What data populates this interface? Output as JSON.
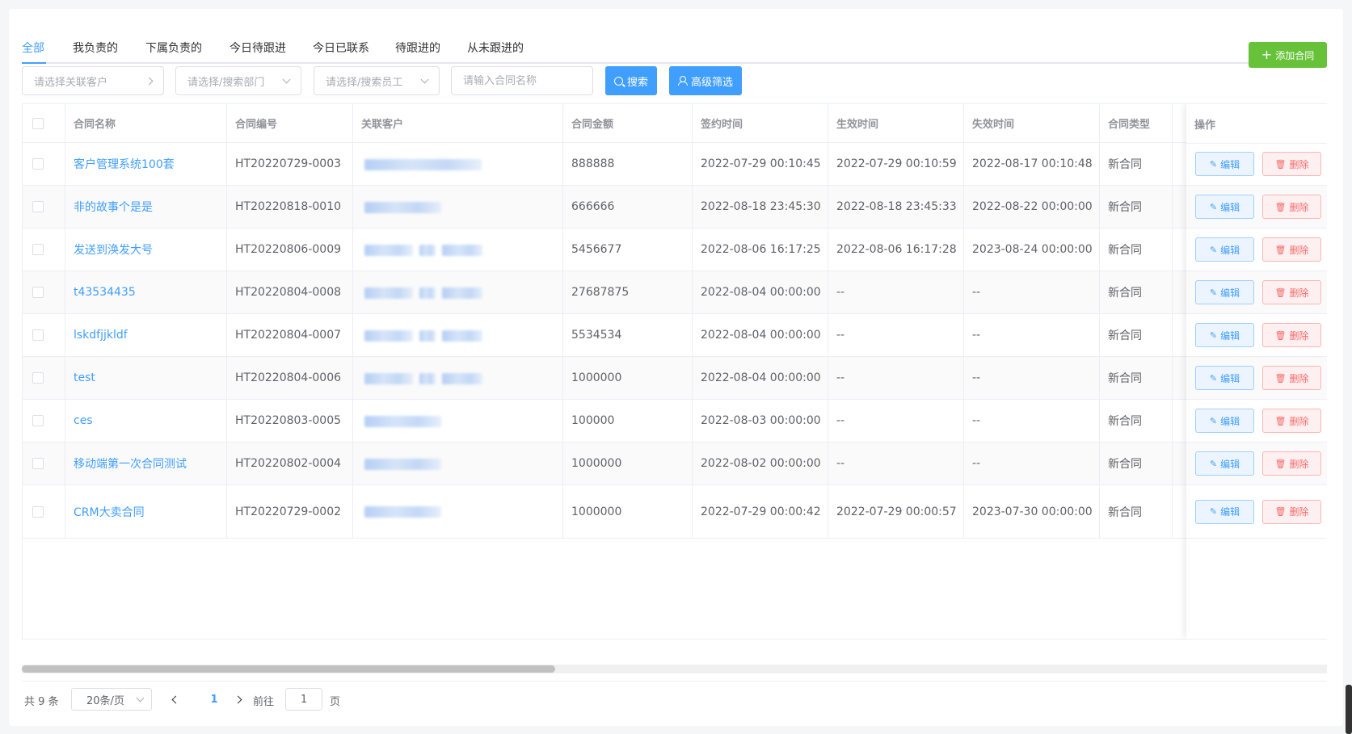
{
  "tabs": [
    "全部",
    "我负责的",
    "下属负责的",
    "今日待跟进",
    "今日已联系",
    "待跟进的",
    "从未跟进的"
  ],
  "add_button": "添加合同",
  "filters": {
    "customer_placeholder": "请选择关联客户",
    "department_placeholder": "请选择/搜索部门",
    "employee_placeholder": "请选择/搜索员工",
    "name_placeholder": "请输入合同名称",
    "search_label": "搜索",
    "advanced_label": "高级筛选"
  },
  "columns": [
    "合同名称",
    "合同编号",
    "关联客户",
    "合同金额",
    "签约时间",
    "生效时间",
    "失效时间",
    "合同类型",
    "操作"
  ],
  "rows": [
    {
      "name": "客户管理系统100套",
      "code": "HT20220729-0003",
      "amount": "888888",
      "signed": "2022-07-29 00:10:45",
      "effective": "2022-07-29 00:10:59",
      "expires": "2022-08-17 00:10:48",
      "type": "新合同"
    },
    {
      "name": "非的故事个是是",
      "code": "HT20220818-0010",
      "amount": "666666",
      "signed": "2022-08-18 23:45:30",
      "effective": "2022-08-18 23:45:33",
      "expires": "2022-08-22 00:00:00",
      "type": "新合同"
    },
    {
      "name": "发送到涣发大号",
      "code": "HT20220806-0009",
      "amount": "5456677",
      "signed": "2022-08-06 16:17:25",
      "effective": "2022-08-06 16:17:28",
      "expires": "2023-08-24 00:00:00",
      "type": "新合同"
    },
    {
      "name": "t43534435",
      "code": "HT20220804-0008",
      "amount": "27687875",
      "signed": "2022-08-04 00:00:00",
      "effective": "--",
      "expires": "--",
      "type": "新合同"
    },
    {
      "name": "lskdfjjkldf",
      "code": "HT20220804-0007",
      "amount": "5534534",
      "signed": "2022-08-04 00:00:00",
      "effective": "--",
      "expires": "--",
      "type": "新合同"
    },
    {
      "name": "test",
      "code": "HT20220804-0006",
      "amount": "1000000",
      "signed": "2022-08-04 00:00:00",
      "effective": "--",
      "expires": "--",
      "type": "新合同"
    },
    {
      "name": "ces",
      "code": "HT20220803-0005",
      "amount": "100000",
      "signed": "2022-08-03 00:00:00",
      "effective": "--",
      "expires": "--",
      "type": "新合同"
    },
    {
      "name": "移动端第一次合同测试",
      "code": "HT20220802-0004",
      "amount": "1000000",
      "signed": "2022-08-02 00:00:00",
      "effective": "--",
      "expires": "--",
      "type": "新合同"
    },
    {
      "name": "CRM大卖合同",
      "code": "HT20220729-0002",
      "amount": "1000000",
      "signed": "2022-07-29 00:00:42",
      "effective": "2022-07-29 00:00:57",
      "expires": "2023-07-30 00:00:00",
      "type": "新合同"
    }
  ],
  "actions": {
    "edit": "编辑",
    "delete": "删除"
  },
  "pagination": {
    "total": "共 9 条",
    "page_size": "20条/页",
    "current_page": "1",
    "goto_label": "前往",
    "goto_value": "1",
    "page_unit": "页"
  },
  "colors": {
    "primary": "#409eff",
    "success": "#67c23a",
    "danger": "#f56c6c"
  }
}
